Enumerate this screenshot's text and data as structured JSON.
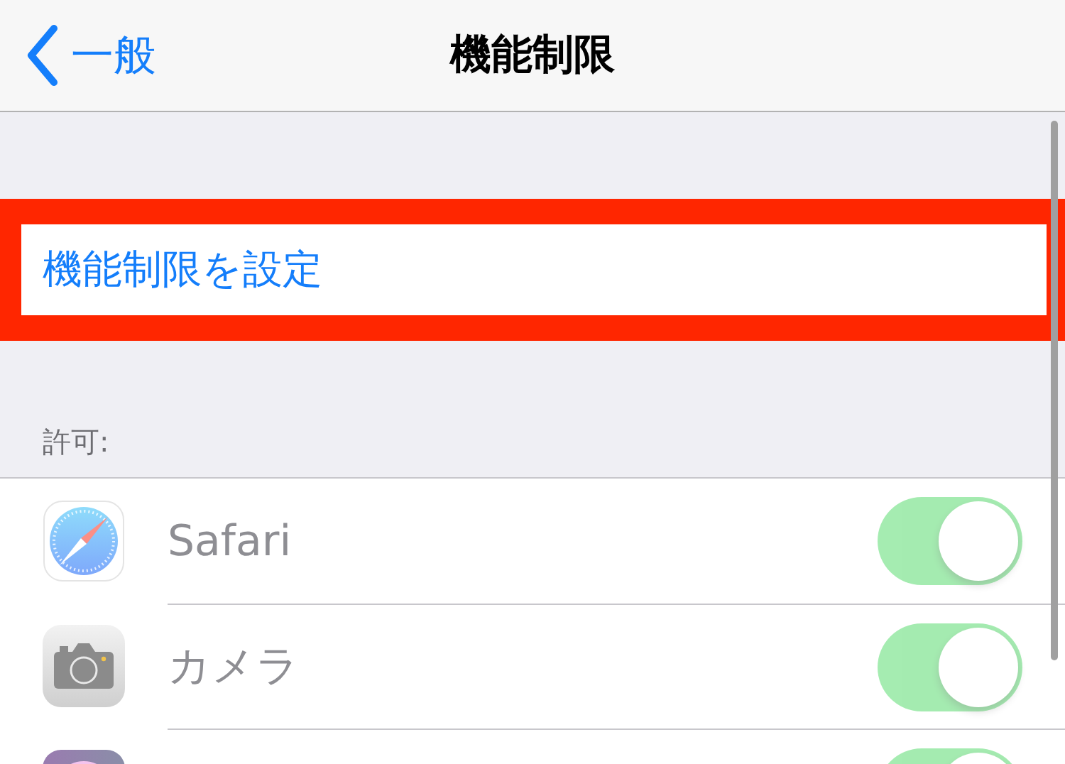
{
  "nav": {
    "back_label": "一般",
    "title": "機能制限"
  },
  "enable_row": {
    "label": "機能制限を設定",
    "highlighted": true
  },
  "section_header": "許可:",
  "apps": [
    {
      "label": "Safari",
      "on": true,
      "disabled": true
    },
    {
      "label": "カメラ",
      "on": true,
      "disabled": true
    },
    {
      "on": true,
      "disabled": true
    }
  ]
}
